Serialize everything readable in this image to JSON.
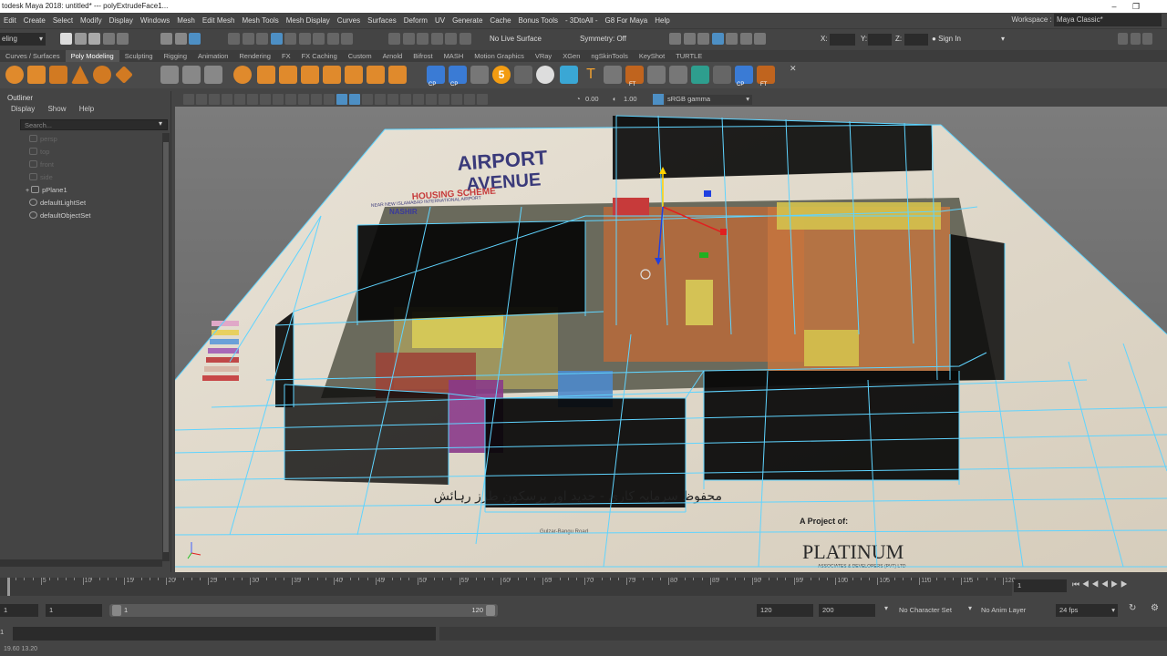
{
  "titlebar": {
    "title": "todesk Maya 2018: untitled*   ---   polyExtrudeFace1..."
  },
  "menubar": {
    "items": [
      "Edit",
      "Create",
      "Select",
      "Modify",
      "Display",
      "Windows",
      "Mesh",
      "Edit Mesh",
      "Mesh Tools",
      "Mesh Display",
      "Curves",
      "Surfaces",
      "Deform",
      "UV",
      "Generate",
      "Cache",
      "Bonus Tools",
      "- 3DtoAll -",
      "G8 For Maya",
      "Help"
    ],
    "workspace_label": "Workspace :",
    "workspace_value": "Maya Classic*"
  },
  "statusline": {
    "mode": "eling",
    "live_surface": "No Live Surface",
    "symmetry": "Symmetry: Off",
    "x_label": "X:",
    "y_label": "Y:",
    "z_label": "Z:",
    "sign_in": "Sign In"
  },
  "shelf": {
    "tabs": [
      "Curves / Surfaces",
      "Poly Modeling",
      "Sculpting",
      "Rigging",
      "Animation",
      "Rendering",
      "FX",
      "FX Caching",
      "Custom",
      "Arnold",
      "Bifrost",
      "MASH",
      "Motion Graphics",
      "VRay",
      "XGen",
      "ngSkinTools",
      "KeyShot",
      "TURTLE"
    ],
    "active_tab": "Poly Modeling",
    "icon_labels": [
      "CP",
      "CP",
      "FT",
      "CP",
      "FT",
      "5",
      "T"
    ]
  },
  "panel": {
    "value_a": "0.00",
    "value_b": "1.00",
    "color_space": "sRGB gamma"
  },
  "outliner": {
    "title": "Outliner",
    "menus": [
      "Display",
      "Show",
      "Help"
    ],
    "search_placeholder": "Search...",
    "items": [
      {
        "label": "persp",
        "dim": true
      },
      {
        "label": "top",
        "dim": true
      },
      {
        "label": "front",
        "dim": true
      },
      {
        "label": "side",
        "dim": true
      },
      {
        "label": "pPlane1",
        "dim": false
      },
      {
        "label": "defaultLightSet",
        "dim": false
      },
      {
        "label": "defaultObjectSet",
        "dim": false
      }
    ]
  },
  "scene": {
    "logo_title_1": "AIRPORT",
    "logo_title_2": "AVENUE",
    "logo_sub": "HOUSING SCHEME",
    "logo_sub2": "NEAR NEW ISLAMABAD INTERNATIONAL AIRPORT",
    "nashir": "NASHIR",
    "urdu_text": "محفوظ سرمایہ کاری - جدید اور پرسکون طرز رہائش",
    "project_of": "A Project of:",
    "platinum": "PLATINUM",
    "platinum_sub": "ASSOCIATES & DEVELOPERS (PVT) LTD",
    "road": "Gulzar-Bangu Road"
  },
  "timeline": {
    "ticks": [
      5,
      10,
      15,
      20,
      25,
      30,
      35,
      40,
      45,
      50,
      55,
      60,
      65,
      70,
      75,
      80,
      85,
      90,
      95,
      100,
      105,
      110,
      115,
      120
    ],
    "current_frame": "1"
  },
  "range": {
    "start": "1",
    "inner_start": "1",
    "inner_end": "120",
    "end": "120",
    "anim_end": "200",
    "character_set": "No Character Set",
    "anim_layer": "No Anim Layer",
    "fps": "24 fps"
  },
  "cmdline": {
    "lang": "1"
  },
  "helpline": {
    "text": "19.60        13.20"
  },
  "colors": {
    "wire": "#5fd4ff",
    "bg": "#444444",
    "field": "#2b2b2b",
    "active_icon": "#4d8fc4"
  }
}
